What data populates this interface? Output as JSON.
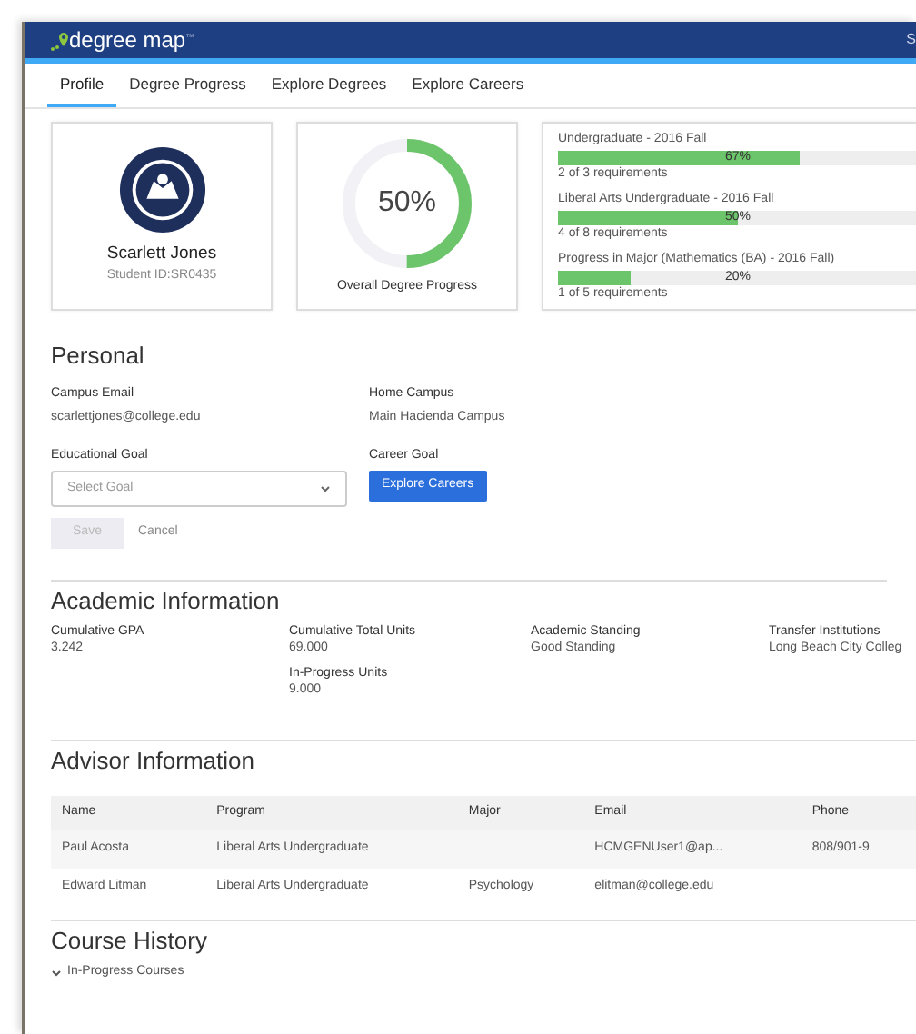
{
  "navbar": {
    "brand": "degree map",
    "brand_mark": "™",
    "user": "S"
  },
  "tabs": [
    {
      "label": "Profile",
      "selected": true
    },
    {
      "label": "Degree Progress",
      "selected": false
    },
    {
      "label": "Explore Degrees",
      "selected": false
    },
    {
      "label": "Explore Careers",
      "selected": false
    }
  ],
  "student": {
    "name": "Scarlett Jones",
    "id": "Student ID:SR0435"
  },
  "overall": {
    "value": "50%",
    "level": 0.5,
    "label": "Overall Degree Progress"
  },
  "programs": [
    {
      "title": "Undergraduate - 2016 Fall",
      "level": 0.67,
      "percent": "67%",
      "requirements": "2 of 3 requirements"
    },
    {
      "title": "Liberal Arts Undergraduate - 2016 Fall",
      "level": 0.5,
      "percent": "50%",
      "requirements": "4 of 8 requirements"
    },
    {
      "title": "Progress in Major (Mathematics (BA) - 2016 Fall)",
      "level": 0.2,
      "percent": "20%",
      "requirements": "1 of 5 requirements"
    }
  ],
  "personal": {
    "heading": "Personal",
    "fields": [
      {
        "label": "Campus Email",
        "value": "scarlettjones@college.edu"
      },
      {
        "label": "Home Campus",
        "value": "Main Hacienda Campus"
      }
    ],
    "goal_label": "Educational Goal",
    "goal_placeholder": "Select Goal",
    "career_label": "Career Goal",
    "career_button": "Explore Careers",
    "save": {
      "label": "Save",
      "disabled": true
    },
    "cancel": "Cancel"
  },
  "academic": {
    "heading": "Academic Information",
    "columns": [
      [
        {
          "label": "Cumulative GPA",
          "value": "3.242"
        }
      ],
      [
        {
          "label": "Cumulative Total Units",
          "value": "69.000"
        },
        {
          "label": "In-Progress Units",
          "value": "9.000"
        }
      ],
      [
        {
          "label": "Academic Standing",
          "value": "Good Standing"
        }
      ],
      [
        {
          "label": "Transfer Institutions",
          "value": "Long Beach City Colleg"
        }
      ]
    ]
  },
  "advisors": {
    "heading": "Advisor Information",
    "columns": [
      "Name",
      "Program",
      "Major",
      "Email",
      "Phone"
    ],
    "rows": [
      [
        "Paul Acosta",
        "Liberal Arts Undergraduate",
        "",
        "HCMGENUser1@ap...",
        "808/901-9"
      ],
      [
        "Edward Litman",
        "Liberal Arts Undergraduate",
        "Psychology",
        "elitman@college.edu",
        ""
      ]
    ]
  },
  "course_history": {
    "heading": "Course History",
    "sections": [
      {
        "label": "In-Progress Courses",
        "expanded": true
      }
    ]
  }
}
